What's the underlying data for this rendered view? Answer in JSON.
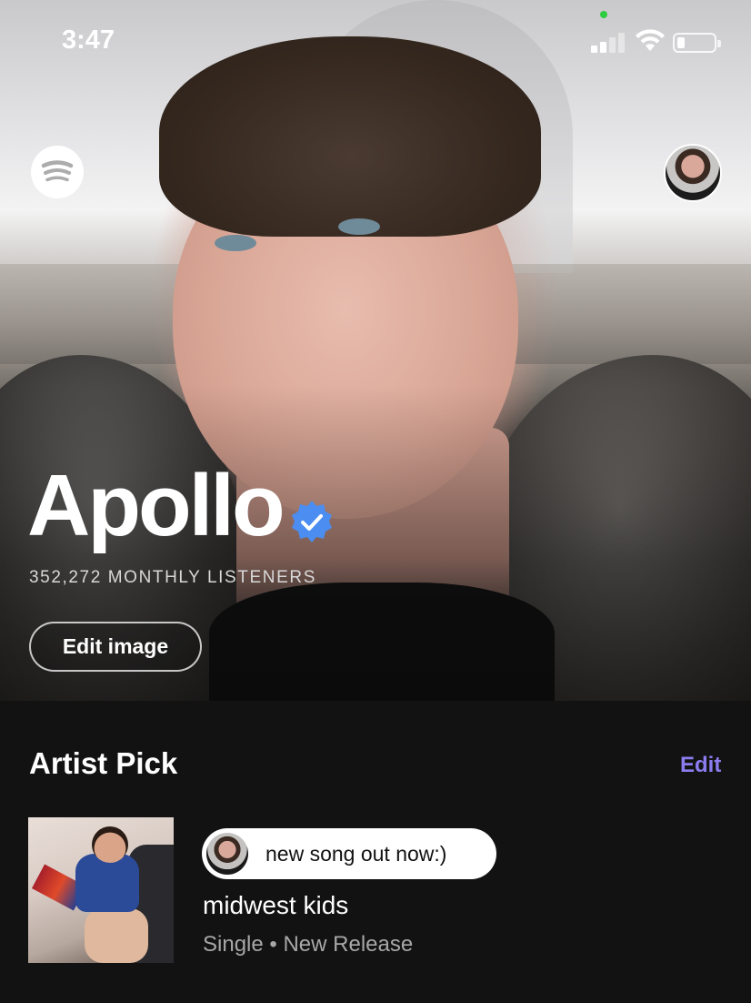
{
  "status_bar": {
    "time": "3:47",
    "signal_icon": "cellular-signal-icon",
    "wifi_icon": "wifi-icon",
    "battery_icon": "battery-icon",
    "battery_level": 0.2
  },
  "header": {
    "logo_icon": "spotify-logo-icon",
    "profile_icon": "profile-avatar"
  },
  "artist": {
    "name": "Apollo",
    "verified_icon": "verified-badge-icon",
    "monthly_listeners": "352,272 MONTHLY LISTENERS",
    "edit_image_label": "Edit image"
  },
  "artist_pick": {
    "section_title": "Artist Pick",
    "edit_label": "Edit",
    "comment": "new song out now:)",
    "release_title": "midwest kids",
    "release_meta": "Single • New Release"
  },
  "colors": {
    "background": "#121212",
    "accent_edit": "#8b7cf0",
    "verified_blue": "#4b8df0",
    "secondary_text": "#a7a7a7"
  }
}
